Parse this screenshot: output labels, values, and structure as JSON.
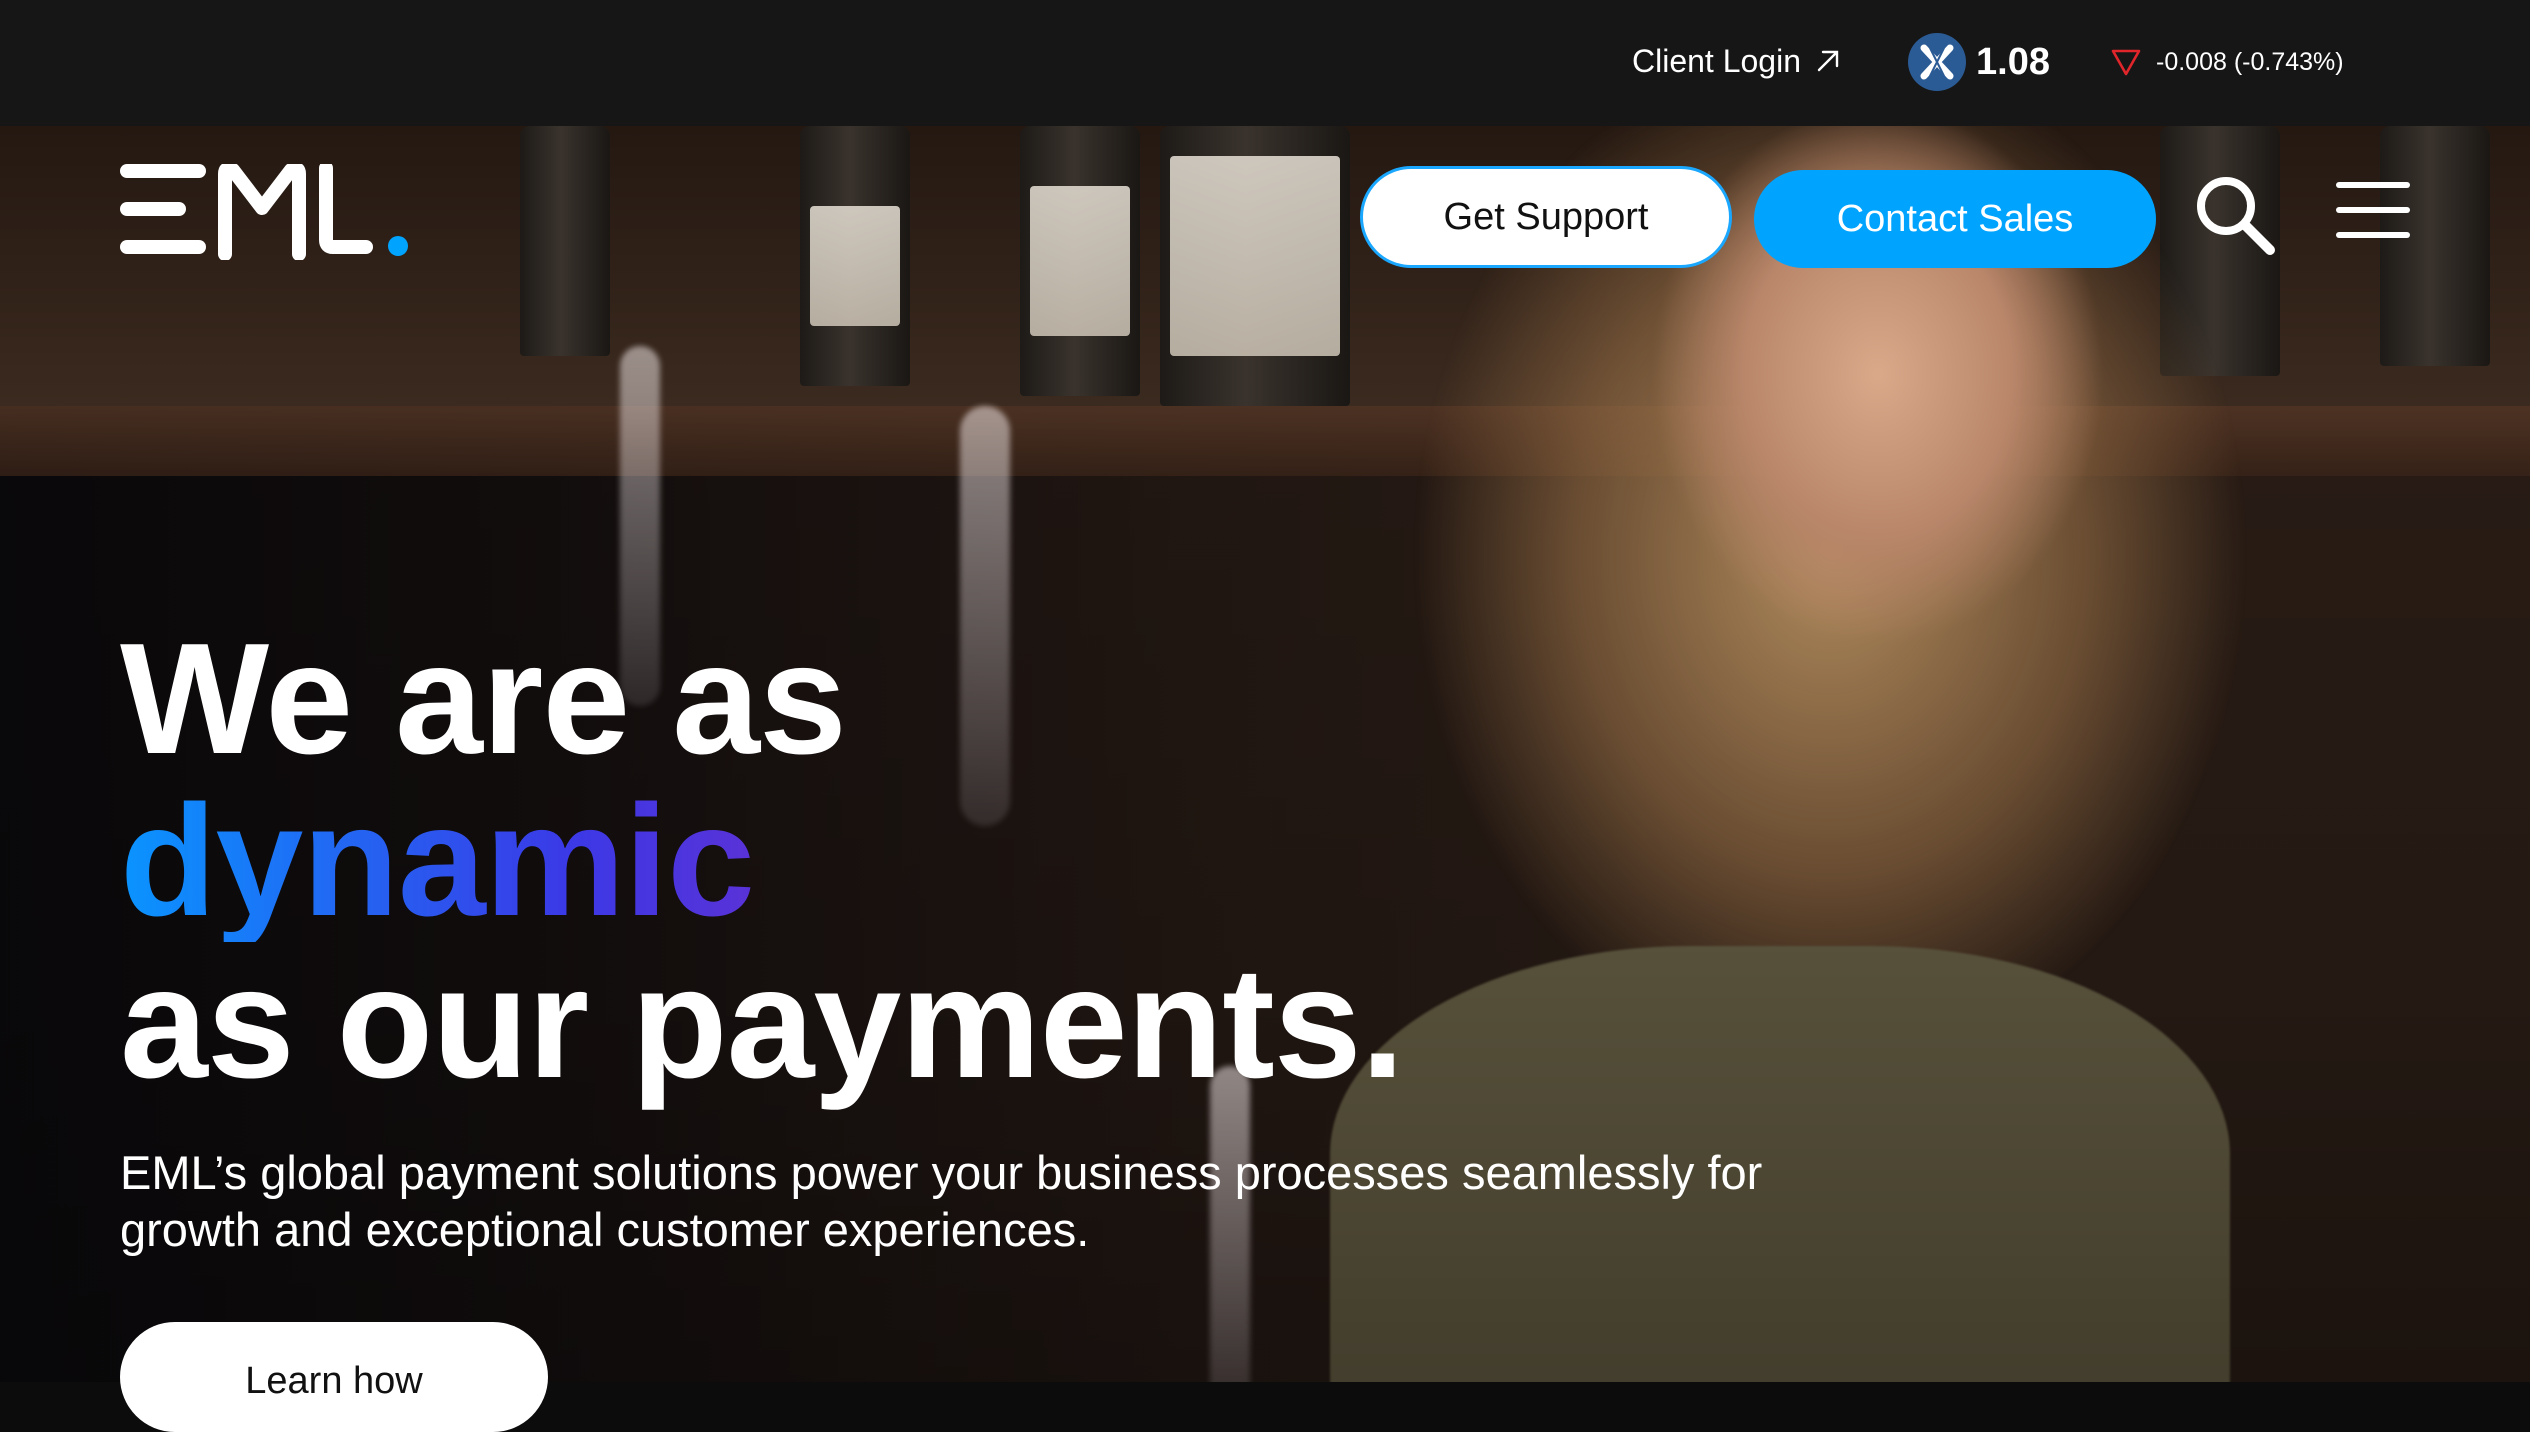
{
  "topbar": {
    "client_login_label": "Client Login",
    "client_login_icon": "arrow-up-right-icon",
    "exchange_icon": "asx-logo-icon",
    "share_price": "1.08",
    "price_change": "-0.008 (-0.743%)",
    "change_icon": "triangle-down-icon",
    "change_color": "#e0262b"
  },
  "header": {
    "logo_text": "EML.",
    "support_button": "Get Support",
    "sales_button": "Contact Sales",
    "search_icon": "search-icon",
    "menu_icon": "hamburger-menu-icon"
  },
  "hero": {
    "headline_line1": "We are as",
    "headline_accent": "dynamic",
    "headline_line3": "as our payments.",
    "subcopy_line1": "EML’s global payment solutions power your business processes seamlessly for",
    "subcopy_line2": "growth and exceptional customer experiences.",
    "cta_button": "Learn how"
  },
  "colors": {
    "accent_blue": "#00a4ff",
    "topbar_bg": "#161616",
    "gradient_start": "#0a94ff",
    "gradient_end": "#d8205e"
  }
}
